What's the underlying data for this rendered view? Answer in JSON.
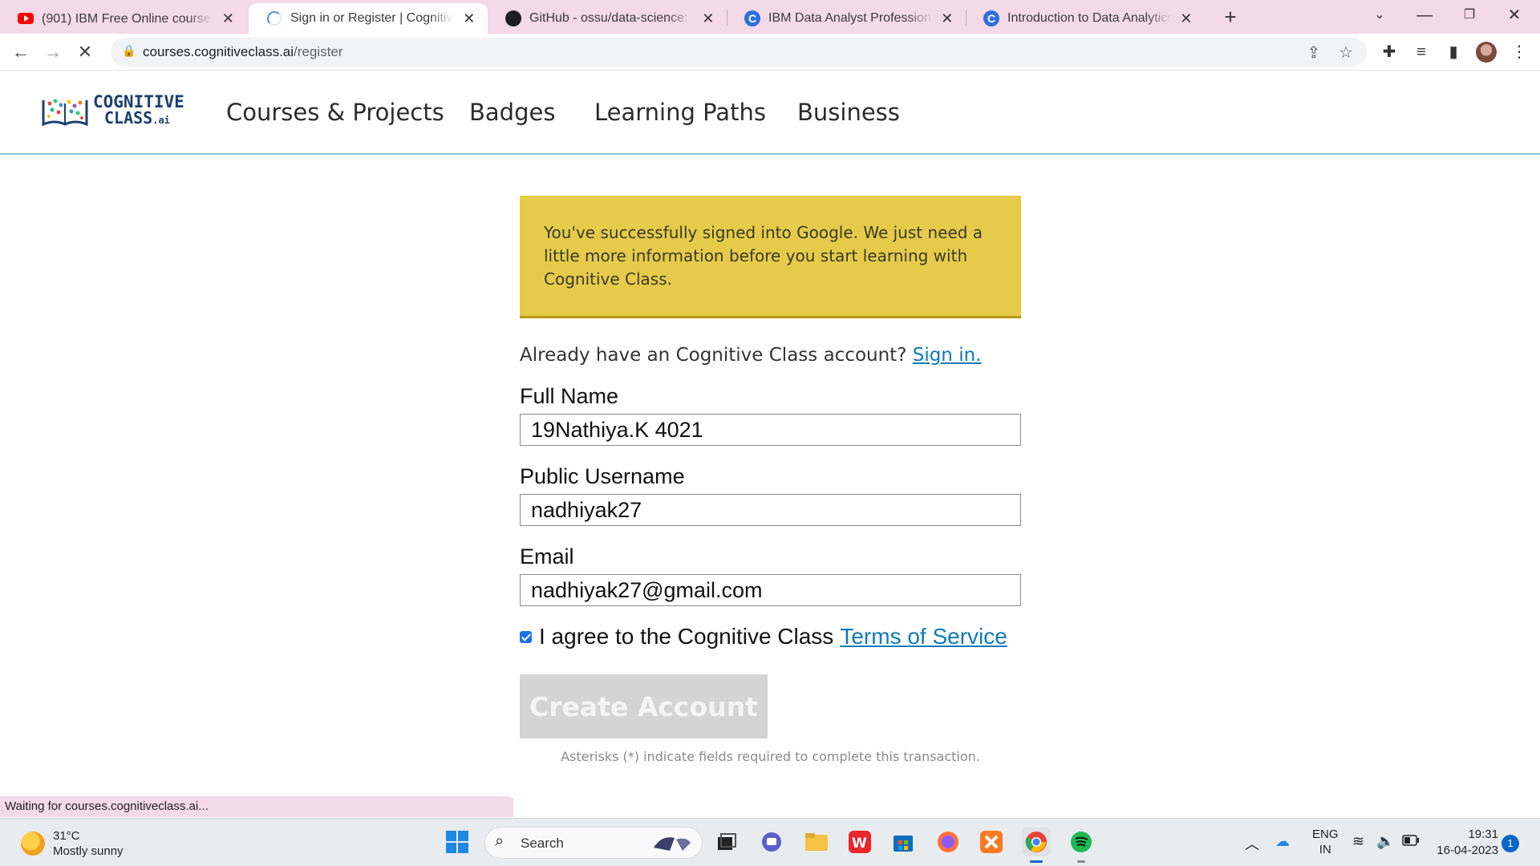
{
  "browser": {
    "tabs": [
      {
        "title": "(901) IBM Free Online course🔥 F",
        "favicon": "youtube-icon",
        "active": false
      },
      {
        "title": "Sign in or Register | Cognitive Cla",
        "favicon": "loading-spinner-icon",
        "active": true
      },
      {
        "title": "GitHub - ossu/data-science: Path",
        "favicon": "github-icon",
        "active": false
      },
      {
        "title": "IBM Data Analyst Professional Ce",
        "favicon": "coursera-icon",
        "active": false
      },
      {
        "title": "Introduction to Data Analytics | C",
        "favicon": "coursera-icon",
        "active": false
      }
    ],
    "url_host": "courses.cognitiveclass.ai",
    "url_path": "/register",
    "status_text": "Waiting for courses.cognitiveclass.ai..."
  },
  "site": {
    "logo_line1": "COGNITIVE",
    "logo_line2": "CLASS",
    "logo_suffix": ".ai",
    "nav": [
      "Courses & Projects",
      "Badges",
      "Learning Paths",
      "Business"
    ]
  },
  "form": {
    "notice": "You've successfully signed into Google. We just need a little more information before you start learning with Cognitive Class.",
    "already_text": "Already have an Cognitive Class account?",
    "signin_link": "Sign in.",
    "full_name_label": "Full Name",
    "full_name_value": "19Nathiya.K 4021",
    "username_label": "Public Username",
    "username_value": "nadhiyak27",
    "email_label": "Email",
    "email_value": "nadhiyak27@gmail.com",
    "agree_text": "I agree to the Cognitive Class",
    "terms_link": "Terms of Service",
    "terms_checked": true,
    "create_button": "Create Account",
    "asterisk_note": "Asterisks (*) indicate fields required to complete this transaction."
  },
  "taskbar": {
    "temperature": "31°C",
    "weather": "Mostly sunny",
    "search_label": "Search",
    "lang1": "ENG",
    "lang2": "IN",
    "time": "19:31",
    "date": "16-04-2023",
    "notification_count": "1"
  },
  "colors": {
    "notice_bg": "#e6cb4a",
    "link": "#0e7ab8",
    "button_disabled": "#d4d4d4",
    "header_border": "#8ec3d6"
  }
}
